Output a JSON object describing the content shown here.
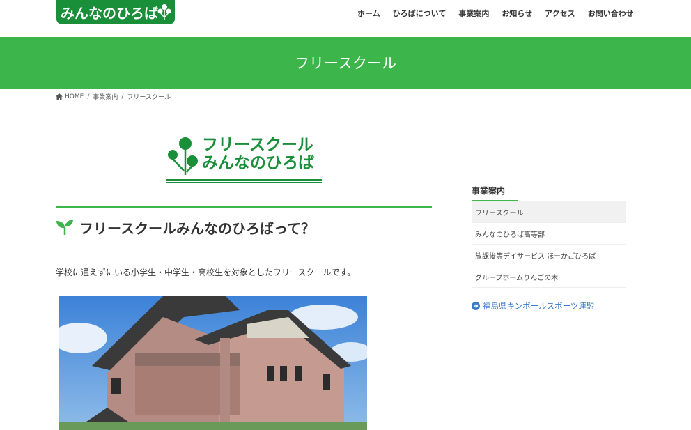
{
  "header": {
    "logo_text": "みんなのひろば",
    "nav": [
      {
        "label": "ホーム",
        "active": false
      },
      {
        "label": "ひろばについて",
        "active": false
      },
      {
        "label": "事業案内",
        "active": true
      },
      {
        "label": "お知らせ",
        "active": false
      },
      {
        "label": "アクセス",
        "active": false
      },
      {
        "label": "お問い合わせ",
        "active": false
      }
    ]
  },
  "banner": {
    "title": "フリースクール"
  },
  "breadcrumb": {
    "home": "HOME",
    "items": [
      "事業案内",
      "フリースクール"
    ]
  },
  "main": {
    "logo_line1": "フリースクール",
    "logo_line2": "みんなのひろば",
    "heading": "フリースクールみんなのひろばって？",
    "intro": "学校に通えずにいる小学生・中学生・高校生を対象としたフリースクールです。"
  },
  "sidebar": {
    "title": "事業案内",
    "items": [
      {
        "label": "フリースクール",
        "active": true
      },
      {
        "label": "みんなのひろば高等部",
        "active": false
      },
      {
        "label": "放課後等デイサービス ほーかごひろば",
        "active": false
      },
      {
        "label": "グループホームりんごの木",
        "active": false
      }
    ],
    "link": "福島県キンボールスポーツ連盟"
  },
  "colors": {
    "brand_green": "#3cb54a",
    "dark_green": "#1a8f3a",
    "link_blue": "#3a7bc8"
  }
}
